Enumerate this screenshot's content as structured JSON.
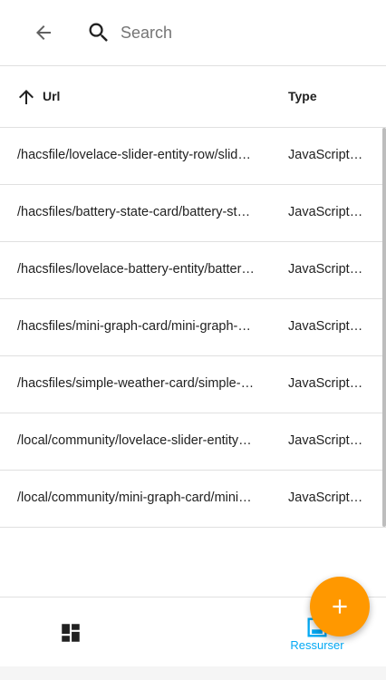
{
  "header": {
    "back_icon": "arrow-left-icon",
    "search_icon": "magnifier-icon",
    "search_placeholder": "Search",
    "search_value": ""
  },
  "table": {
    "sort_icon": "arrow-up-icon",
    "columns": {
      "url": "Url",
      "type": "Type"
    },
    "rows": [
      {
        "url": "/hacsfile/lovelace-slider-entity-row/slider-entity-row.js",
        "type": "JavaScript-modul"
      },
      {
        "url": "/hacsfiles/battery-state-card/battery-state-card.js",
        "type": "JavaScript-modul"
      },
      {
        "url": "/hacsfiles/lovelace-battery-entity/battery-entity.js",
        "type": "JavaScript-modul"
      },
      {
        "url": "/hacsfiles/mini-graph-card/mini-graph-card-bundle.js",
        "type": "JavaScript-modul"
      },
      {
        "url": "/hacsfiles/simple-weather-card/simple-weather-card-bundle.js",
        "type": "JavaScript-modul"
      },
      {
        "url": "/local/community/lovelace-slider-entity-row/slider-entity-row.js",
        "type": "JavaScript-modul"
      },
      {
        "url": "/local/community/mini-graph-card/mini-graph-card-bundle.js",
        "type": "JavaScript-modul"
      }
    ]
  },
  "bottom_nav": {
    "overview_icon": "dashboard-icon",
    "resources_icon": "resources-icon",
    "resources_label": "Ressurser"
  },
  "fab": {
    "icon": "plus-icon"
  },
  "colors": {
    "accent": "#03a9f4",
    "fab": "#ff9800",
    "divider": "#e0e0e0"
  }
}
